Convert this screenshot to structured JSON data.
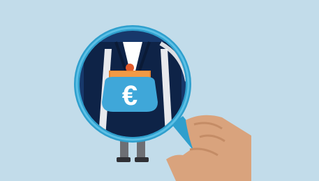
{
  "illustration": {
    "subject": "magnifying-glass-over-person-with-euro-purse",
    "currency_symbol": "€",
    "colors": {
      "background": "#c2dcea",
      "lens_ring": "#2f9fcd",
      "lens_inner": "#17386b",
      "suit": "#0e2347",
      "shirt": "#ffffff",
      "purse_body": "#3fa7d9",
      "purse_frame": "#e8852f",
      "purse_clasp": "#e25a2b",
      "hand": "#d9a37d",
      "legs": "#6d6f74"
    }
  }
}
